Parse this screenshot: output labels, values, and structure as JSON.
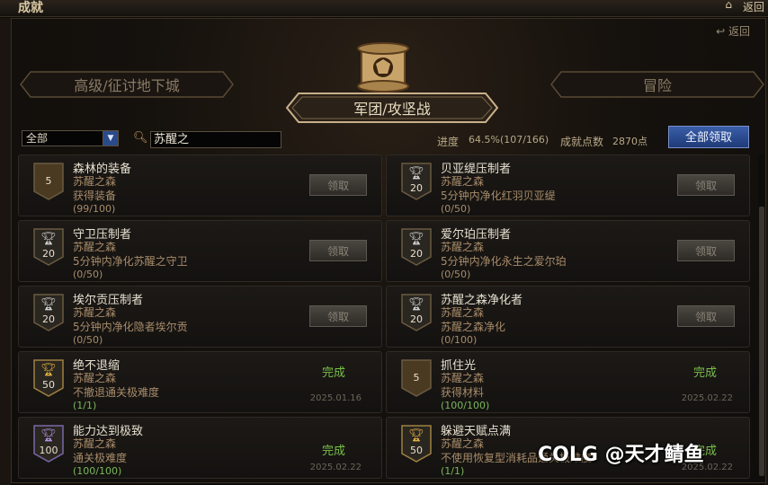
{
  "window": {
    "title": "成就",
    "home_icon": "home-icon",
    "back_label": "返回"
  },
  "header": {
    "return_link": "返回",
    "tabs": [
      {
        "label": "高级/征讨地下城",
        "active": false
      },
      {
        "label": "军团/攻坚战",
        "active": true
      },
      {
        "label": "冒险",
        "active": false
      }
    ]
  },
  "filter": {
    "selected": "全部",
    "search_value": "苏醒之"
  },
  "stats": {
    "progress_label": "进度",
    "progress_value": "64.5%(107/166)",
    "points_label": "成就点数",
    "points_value": "2870点",
    "claim_all_label": "全部领取"
  },
  "achievements": [
    {
      "name": "森林的装备",
      "location": "苏醒之森",
      "desc": "获得装备",
      "progress": "(99/100)",
      "points": "5",
      "icon": "plain-badge",
      "claim": "领取",
      "status": "",
      "date": ""
    },
    {
      "name": "贝亚缇压制者",
      "location": "苏醒之森",
      "desc": "5分钟内净化红羽贝亚缇",
      "progress": "(0/50)",
      "points": "20",
      "icon": "silver-trophy",
      "claim": "领取",
      "status": "",
      "date": ""
    },
    {
      "name": "守卫压制者",
      "location": "苏醒之森",
      "desc": "5分钟内净化苏醒之守卫",
      "progress": "(0/50)",
      "points": "20",
      "icon": "silver-trophy",
      "claim": "领取",
      "status": "",
      "date": ""
    },
    {
      "name": "爱尔珀压制者",
      "location": "苏醒之森",
      "desc": "5分钟内净化永生之爱尔珀",
      "progress": "(0/50)",
      "points": "20",
      "icon": "silver-trophy",
      "claim": "领取",
      "status": "",
      "date": ""
    },
    {
      "name": "埃尔贡压制者",
      "location": "苏醒之森",
      "desc": "5分钟内净化隐者埃尔贡",
      "progress": "(0/50)",
      "points": "20",
      "icon": "silver-trophy",
      "claim": "领取",
      "status": "",
      "date": ""
    },
    {
      "name": "苏醒之森净化者",
      "location": "苏醒之森",
      "desc": "苏醒之森净化",
      "progress": "(0/100)",
      "points": "20",
      "icon": "silver-trophy",
      "claim": "领取",
      "status": "",
      "date": ""
    },
    {
      "name": "绝不退缩",
      "location": "苏醒之森",
      "desc": "不撤退通关极难度",
      "progress": "(1/1)",
      "points": "50",
      "icon": "gold-trophy",
      "claim": "",
      "status": "完成",
      "date": "2025.01.16"
    },
    {
      "name": "抓住光",
      "location": "苏醒之森",
      "desc": "获得材料",
      "progress": "(100/100)",
      "points": "5",
      "icon": "plain-badge",
      "claim": "",
      "status": "完成",
      "date": "2025.02.22"
    },
    {
      "name": "能力达到极致",
      "location": "苏醒之森",
      "desc": "通关极难度",
      "progress": "(100/100)",
      "points": "100",
      "icon": "purple-trophy",
      "claim": "",
      "status": "完成",
      "date": "2025.02.22"
    },
    {
      "name": "躲避天赋点满",
      "location": "苏醒之森",
      "desc": "不使用恢复型消耗品通关极难度",
      "progress": "(1/1)",
      "points": "50",
      "icon": "gold-trophy",
      "claim": "",
      "status": "完成",
      "date": "2025.02.22"
    }
  ],
  "watermark": "COLG @天才鲭鱼",
  "colors": {
    "gold_trophy": "#e0b040",
    "silver_trophy": "#d0d0d0",
    "purple_trophy": "#b090e0",
    "complete_green": "#7ac04a",
    "claim_all_blue": "#2a4a8a"
  }
}
